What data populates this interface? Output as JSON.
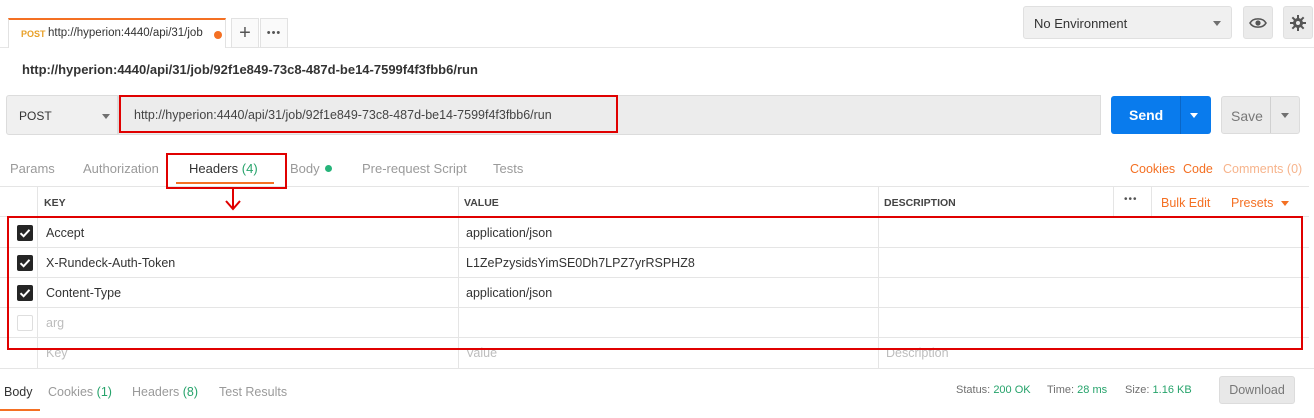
{
  "tab": {
    "method": "POST",
    "title": "http://hyperion:4440/api/31/job"
  },
  "environment": {
    "selected": "No Environment"
  },
  "request": {
    "title": "http://hyperion:4440/api/31/job/92f1e849-73c8-487d-be14-7599f4f3fbb6/run",
    "method": "POST",
    "url": "http://hyperion:4440/api/31/job/92f1e849-73c8-487d-be14-7599f4f3fbb6/run",
    "send_label": "Send",
    "save_label": "Save"
  },
  "request_tabs": {
    "params": "Params",
    "authorization": "Authorization",
    "headers": "Headers",
    "headers_count": "(4)",
    "body": "Body",
    "prerequest": "Pre-request Script",
    "tests": "Tests"
  },
  "right_links": {
    "cookies": "Cookies",
    "code": "Code",
    "comments": "Comments (0)"
  },
  "headers_table": {
    "columns": {
      "key": "KEY",
      "value": "VALUE",
      "description": "DESCRIPTION"
    },
    "more": "•••",
    "bulk_edit": "Bulk Edit",
    "presets": "Presets",
    "rows": [
      {
        "key": "Accept",
        "value": "application/json",
        "checked": true
      },
      {
        "key": "X-Rundeck-Auth-Token",
        "value": "L1ZePzysidsYimSE0Dh7LPZ7yrRSPHZ8",
        "checked": true
      },
      {
        "key": "Content-Type",
        "value": "application/json",
        "checked": true
      },
      {
        "key": "arg",
        "value": "",
        "checked": false
      }
    ],
    "placeholder": {
      "key": "Key",
      "value": "Value",
      "description": "Description"
    }
  },
  "response": {
    "body": "Body",
    "cookies": "Cookies",
    "cookies_count": "(1)",
    "headers": "Headers",
    "headers_count": "(8)",
    "test_results": "Test Results",
    "status_label": "Status:",
    "status_value": "200 OK",
    "time_label": "Time:",
    "time_value": "28 ms",
    "size_label": "Size:",
    "size_value": "1.16 KB",
    "download_label": "Download"
  },
  "colors": {
    "accent": "#f47023",
    "send": "#097bed",
    "success": "#26a36b",
    "annotation": "#e00000"
  }
}
